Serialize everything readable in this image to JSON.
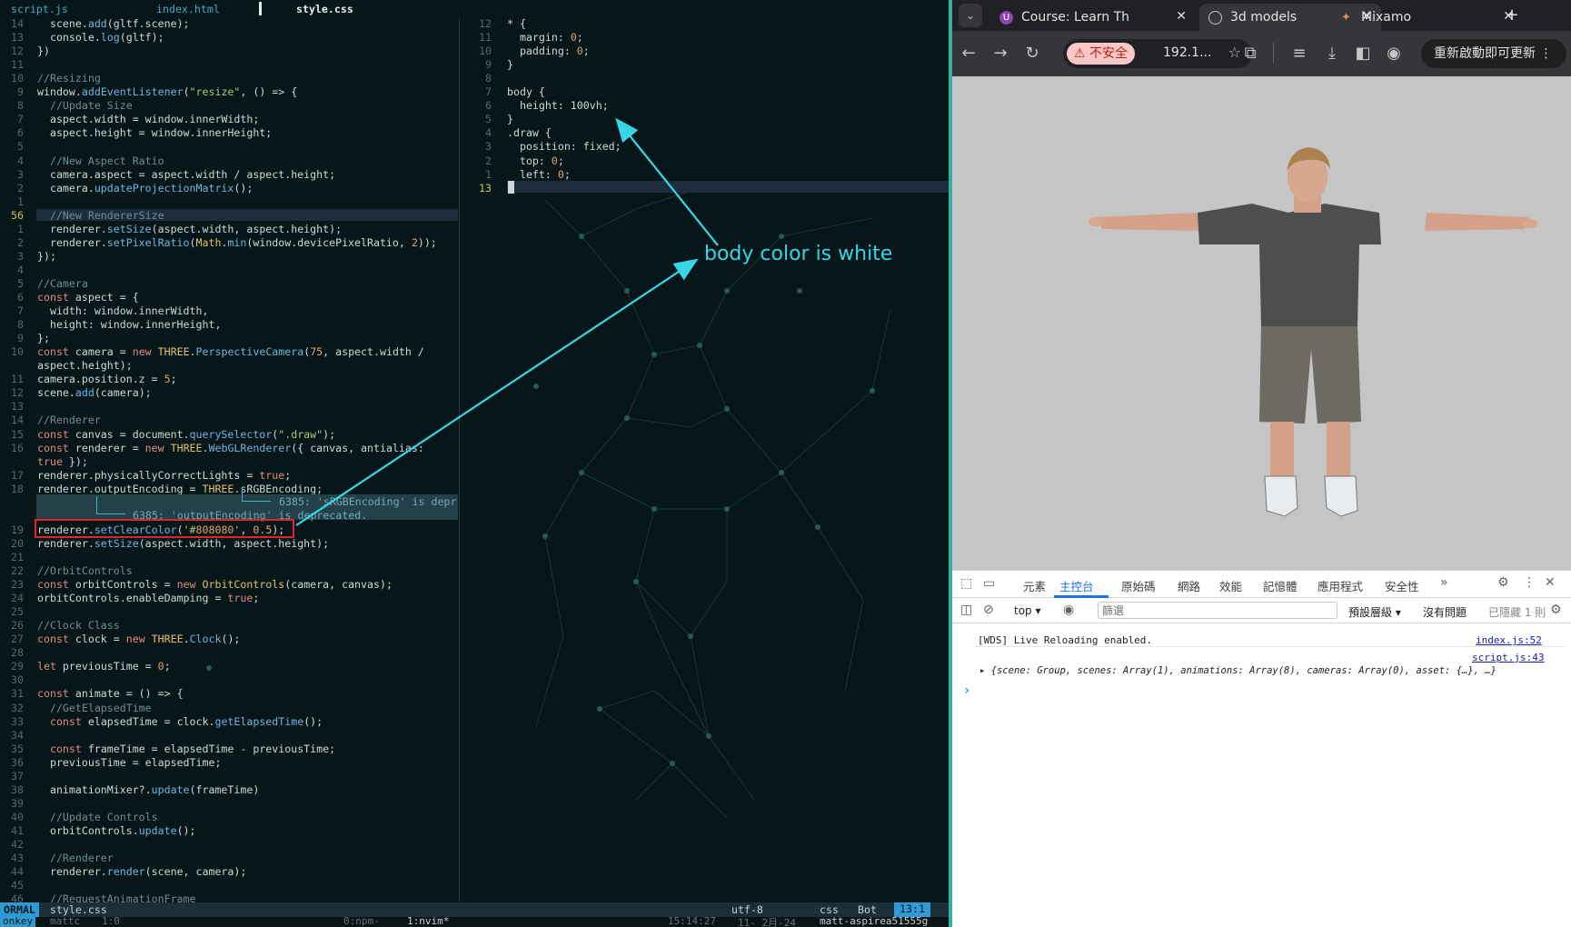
{
  "editor": {
    "tabs": [
      {
        "label": "script.js"
      },
      {
        "label": "index.html"
      },
      {
        "label": "style.css"
      }
    ],
    "left_pane": {
      "lines": [
        {
          "n": "14",
          "t": "  scene.add(gltf.scene);"
        },
        {
          "n": "13",
          "t": "  console.log(gltf);"
        },
        {
          "n": "12",
          "t": "})"
        },
        {
          "n": "11",
          "t": ""
        },
        {
          "n": "10",
          "t": "//Resizing"
        },
        {
          "n": "9",
          "t": "window.addEventListener(\"resize\", () => {"
        },
        {
          "n": "8",
          "t": "  //Update Size"
        },
        {
          "n": "7",
          "t": "  aspect.width = window.innerWidth;"
        },
        {
          "n": "6",
          "t": "  aspect.height = window.innerHeight;"
        },
        {
          "n": "5",
          "t": ""
        },
        {
          "n": "4",
          "t": "  //New Aspect Ratio"
        },
        {
          "n": "3",
          "t": "  camera.aspect = aspect.width / aspect.height;"
        },
        {
          "n": "2",
          "t": "  camera.updateProjectionMatrix();"
        },
        {
          "n": "1",
          "t": ""
        },
        {
          "n": "56",
          "t": "  //New RendererSize"
        },
        {
          "n": "1",
          "t": "  renderer.setSize(aspect.width, aspect.height);"
        },
        {
          "n": "2",
          "t": "  renderer.setPixelRatio(Math.min(window.devicePixelRatio, 2));"
        },
        {
          "n": "3",
          "t": "});"
        },
        {
          "n": "4",
          "t": ""
        },
        {
          "n": "5",
          "t": "//Camera"
        },
        {
          "n": "6",
          "t": "const aspect = {"
        },
        {
          "n": "7",
          "t": "  width: window.innerWidth,"
        },
        {
          "n": "8",
          "t": "  height: window.innerHeight,"
        },
        {
          "n": "9",
          "t": "};"
        },
        {
          "n": "10",
          "t": "const camera = new THREE.PerspectiveCamera(75, aspect.width /"
        },
        {
          "n": "",
          "t": "aspect.height);"
        },
        {
          "n": "11",
          "t": "camera.position.z = 5;"
        },
        {
          "n": "12",
          "t": "scene.add(camera);"
        },
        {
          "n": "13",
          "t": ""
        },
        {
          "n": "14",
          "t": "//Renderer"
        },
        {
          "n": "15",
          "t": "const canvas = document.querySelector(\".draw\");"
        },
        {
          "n": "16",
          "t": "const renderer = new THREE.WebGLRenderer({ canvas, antialias:"
        },
        {
          "n": "",
          "t": "true });"
        },
        {
          "n": "17",
          "t": "renderer.physicallyCorrectLights = true;"
        },
        {
          "n": "18",
          "t": "renderer.outputEncoding = THREE.sRGBEncoding;"
        },
        {
          "n": "",
          "t": ""
        },
        {
          "n": "",
          "t": ""
        },
        {
          "n": "19",
          "t": "renderer.setClearColor('#808080', 0.5);"
        },
        {
          "n": "20",
          "t": "renderer.setSize(aspect.width, aspect.height);"
        },
        {
          "n": "21",
          "t": ""
        },
        {
          "n": "22",
          "t": "//OrbitControls"
        },
        {
          "n": "23",
          "t": "const orbitControls = new OrbitControls(camera, canvas);"
        },
        {
          "n": "24",
          "t": "orbitControls.enableDamping = true;"
        },
        {
          "n": "25",
          "t": ""
        },
        {
          "n": "26",
          "t": "//Clock Class"
        },
        {
          "n": "27",
          "t": "const clock = new THREE.Clock();"
        },
        {
          "n": "28",
          "t": ""
        },
        {
          "n": "29",
          "t": "let previousTime = 0;"
        },
        {
          "n": "30",
          "t": ""
        },
        {
          "n": "31",
          "t": "const animate = () => {"
        },
        {
          "n": "32",
          "t": "  //GetElapsedTime"
        },
        {
          "n": "33",
          "t": "  const elapsedTime = clock.getElapsedTime();"
        },
        {
          "n": "34",
          "t": ""
        },
        {
          "n": "35",
          "t": "  const frameTime = elapsedTime - previousTime;"
        },
        {
          "n": "36",
          "t": "  previousTime = elapsedTime;"
        },
        {
          "n": "37",
          "t": ""
        },
        {
          "n": "38",
          "t": "  animationMixer?.update(frameTime)"
        },
        {
          "n": "39",
          "t": ""
        },
        {
          "n": "40",
          "t": "  //Update Controls"
        },
        {
          "n": "41",
          "t": "  orbitControls.update();"
        },
        {
          "n": "42",
          "t": ""
        },
        {
          "n": "43",
          "t": "  //Renderer"
        },
        {
          "n": "44",
          "t": "  renderer.render(scene, camera);"
        },
        {
          "n": "45",
          "t": ""
        },
        {
          "n": "46",
          "t": "  //RequestAnimationFrame"
        }
      ],
      "diagnostics": [
        "6385: 'sRGBEncoding' is depr",
        "6385: 'outputEncoding' is deprecated."
      ]
    },
    "right_pane": {
      "lines": [
        {
          "n": "12",
          "t": "* {"
        },
        {
          "n": "11",
          "t": "  margin: 0;"
        },
        {
          "n": "10",
          "t": "  padding: 0;"
        },
        {
          "n": "9",
          "t": "}"
        },
        {
          "n": "8",
          "t": ""
        },
        {
          "n": "7",
          "t": "body {"
        },
        {
          "n": "6",
          "t": "  height: 100vh;"
        },
        {
          "n": "5",
          "t": "}"
        },
        {
          "n": "4",
          "t": ".draw {"
        },
        {
          "n": "3",
          "t": "  position: fixed;"
        },
        {
          "n": "2",
          "t": "  top: 0;"
        },
        {
          "n": "1",
          "t": "  left: 0;"
        },
        {
          "n": "13",
          "t": "}"
        }
      ]
    },
    "annotation": "body color is white",
    "statusline": {
      "mode": "ORMAL",
      "file": "style.css",
      "encoding": "utf-8",
      "filetype": "css",
      "position_label": "Bot",
      "cursor": "13:1"
    },
    "tmux": {
      "session": "onkey",
      "user": "mattc",
      "pane": "1:0",
      "win0": "0:npm-",
      "win1": "1:nvim*",
      "time": "15:14:27",
      "date": "11- 2月-24",
      "host": "matt-aspirea51555g"
    }
  },
  "browser": {
    "tabs": [
      {
        "title": "Course: Learn Th",
        "active": false
      },
      {
        "title": "3d models",
        "active": true
      },
      {
        "title": "Mixamo",
        "active": false
      }
    ],
    "insecure_label": "不安全",
    "url": "192.1...",
    "update_button": "重新啟動即可更新",
    "viewport_bg": "#c5c5c5",
    "devtools": {
      "tabs": [
        "元素",
        "主控台",
        "原始碼",
        "網路",
        "效能",
        "記憶體",
        "應用程式",
        "安全性"
      ],
      "active_tab": "主控台",
      "context": "top",
      "filter_placeholder": "篩選",
      "levels": "預設層級",
      "issues": "沒有問題",
      "hidden": "已隱藏 1 則",
      "console": [
        {
          "text": "[WDS] Live Reloading enabled.",
          "source": "index.js:52"
        },
        {
          "text": "{scene: Group, scenes: Array(1), animations: Array(8), cameras: Array(0), asset: {…}, …}",
          "source": "script.js:43"
        }
      ],
      "prompt": "›"
    }
  },
  "colors": {
    "annotation": "#36d6e7",
    "highlight_box": "#e0252a",
    "divider": "#2fb2a4"
  }
}
